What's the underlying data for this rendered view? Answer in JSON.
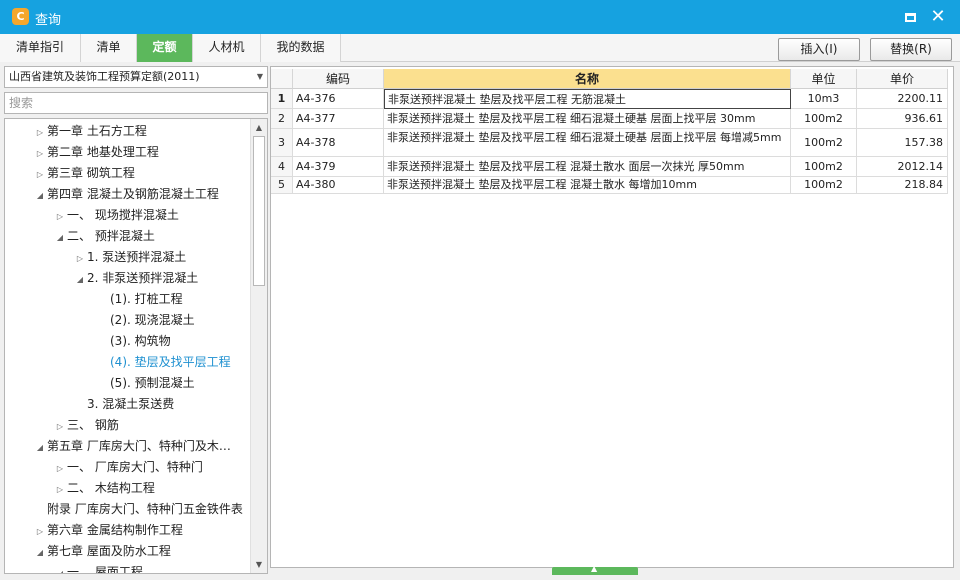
{
  "window": {
    "title": "查询"
  },
  "tabs": [
    {
      "label": "清单指引",
      "active": false
    },
    {
      "label": "清单",
      "active": false
    },
    {
      "label": "定额",
      "active": true
    },
    {
      "label": "人材机",
      "active": false
    },
    {
      "label": "我的数据",
      "active": false
    }
  ],
  "toolbar": {
    "insert_label": "插入(I)",
    "replace_label": "替换(R)"
  },
  "library": {
    "selected": "山西省建筑及装饰工程预算定额(2011)"
  },
  "search": {
    "placeholder": "搜索",
    "value": ""
  },
  "tree": [
    {
      "label": "第一章  土石方工程",
      "toggle": "collapsed",
      "level": 1
    },
    {
      "label": "第二章  地基处理工程",
      "toggle": "collapsed",
      "level": 1
    },
    {
      "label": "第三章  砌筑工程",
      "toggle": "collapsed",
      "level": 1
    },
    {
      "label": "第四章  混凝土及钢筋混凝土工程",
      "toggle": "expanded",
      "level": 1
    },
    {
      "label": "一、 现场搅拌混凝土",
      "toggle": "collapsed",
      "level": 2
    },
    {
      "label": "二、 预拌混凝土",
      "toggle": "expanded",
      "level": 2
    },
    {
      "label": "1. 泵送预拌混凝土",
      "toggle": "collapsed",
      "level": 3
    },
    {
      "label": "2. 非泵送预拌混凝土",
      "toggle": "expanded",
      "level": 3
    },
    {
      "label": "(1). 打桩工程",
      "toggle": "none",
      "level": 4
    },
    {
      "label": "(2). 现浇混凝土",
      "toggle": "none",
      "level": 4
    },
    {
      "label": "(3). 构筑物",
      "toggle": "none",
      "level": 4
    },
    {
      "label": "(4). 垫层及找平层工程",
      "toggle": "none",
      "level": 4,
      "selected": true
    },
    {
      "label": "(5). 预制混凝土",
      "toggle": "none",
      "level": 4
    },
    {
      "label": "3. 混凝土泵送费",
      "toggle": "none",
      "level": 3
    },
    {
      "label": "三、 钢筋",
      "toggle": "collapsed",
      "level": 2
    },
    {
      "label": "第五章  厂库房大门、特种门及木…",
      "toggle": "expanded",
      "level": 1
    },
    {
      "label": "一、 厂库房大门、特种门",
      "toggle": "collapsed",
      "level": 2
    },
    {
      "label": "二、 木结构工程",
      "toggle": "collapsed",
      "level": 2
    },
    {
      "label": "附录  厂库房大门、特种门五金铁件表",
      "toggle": "none",
      "level": 1
    },
    {
      "label": "第六章  金属结构制作工程",
      "toggle": "collapsed",
      "level": 1
    },
    {
      "label": "第七章  屋面及防水工程",
      "toggle": "expanded",
      "level": 1
    },
    {
      "label": "一、 屋面工程",
      "toggle": "expanded",
      "level": 2
    }
  ],
  "grid": {
    "headers": {
      "code": "编码",
      "name": "名称",
      "unit": "单位",
      "price": "单价"
    },
    "rows": [
      {
        "num": "1",
        "code": "A4-376",
        "name": "非泵送预拌混凝土 垫层及找平层工程 无筋混凝土",
        "unit": "10m3",
        "price": "2200.11"
      },
      {
        "num": "2",
        "code": "A4-377",
        "name": "非泵送预拌混凝土 垫层及找平层工程 细石混凝土硬基 层面上找平层 30mm",
        "unit": "100m2",
        "price": "936.61"
      },
      {
        "num": "3",
        "code": "A4-378",
        "name": "非泵送预拌混凝土 垫层及找平层工程 细石混凝土硬基 层面上找平层 每增减5mm",
        "unit": "100m2",
        "price": "157.38"
      },
      {
        "num": "4",
        "code": "A4-379",
        "name": "非泵送预拌混凝土 垫层及找平层工程 混凝土散水 面层一次抹光 厚50mm",
        "unit": "100m2",
        "price": "2012.14"
      },
      {
        "num": "5",
        "code": "A4-380",
        "name": "非泵送预拌混凝土 垫层及找平层工程 混凝土散水 每增加10mm",
        "unit": "100m2",
        "price": "218.84"
      }
    ]
  }
}
